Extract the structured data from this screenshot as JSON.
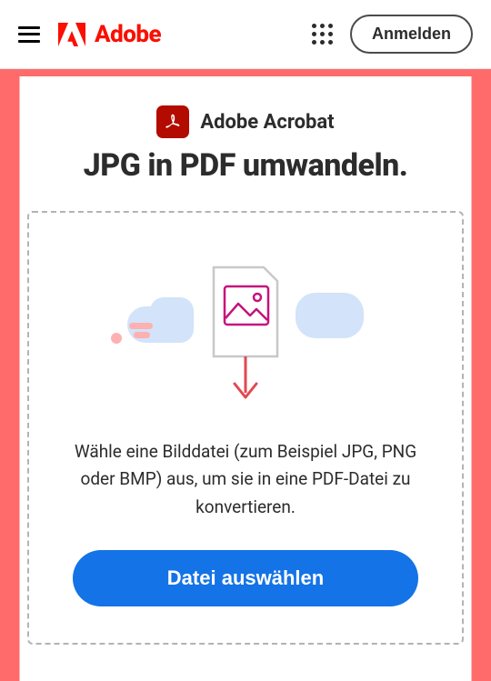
{
  "header": {
    "brand": "Adobe",
    "signin_label": "Anmelden"
  },
  "app": {
    "name": "Adobe Acrobat"
  },
  "main": {
    "headline": "JPG in PDF umwandeln.",
    "instructions": "Wähle eine Bilddatei (zum Beispiel JPG, PNG oder BMP) aus, um sie in eine PDF-Datei zu konvertieren.",
    "select_button_label": "Datei auswählen"
  }
}
